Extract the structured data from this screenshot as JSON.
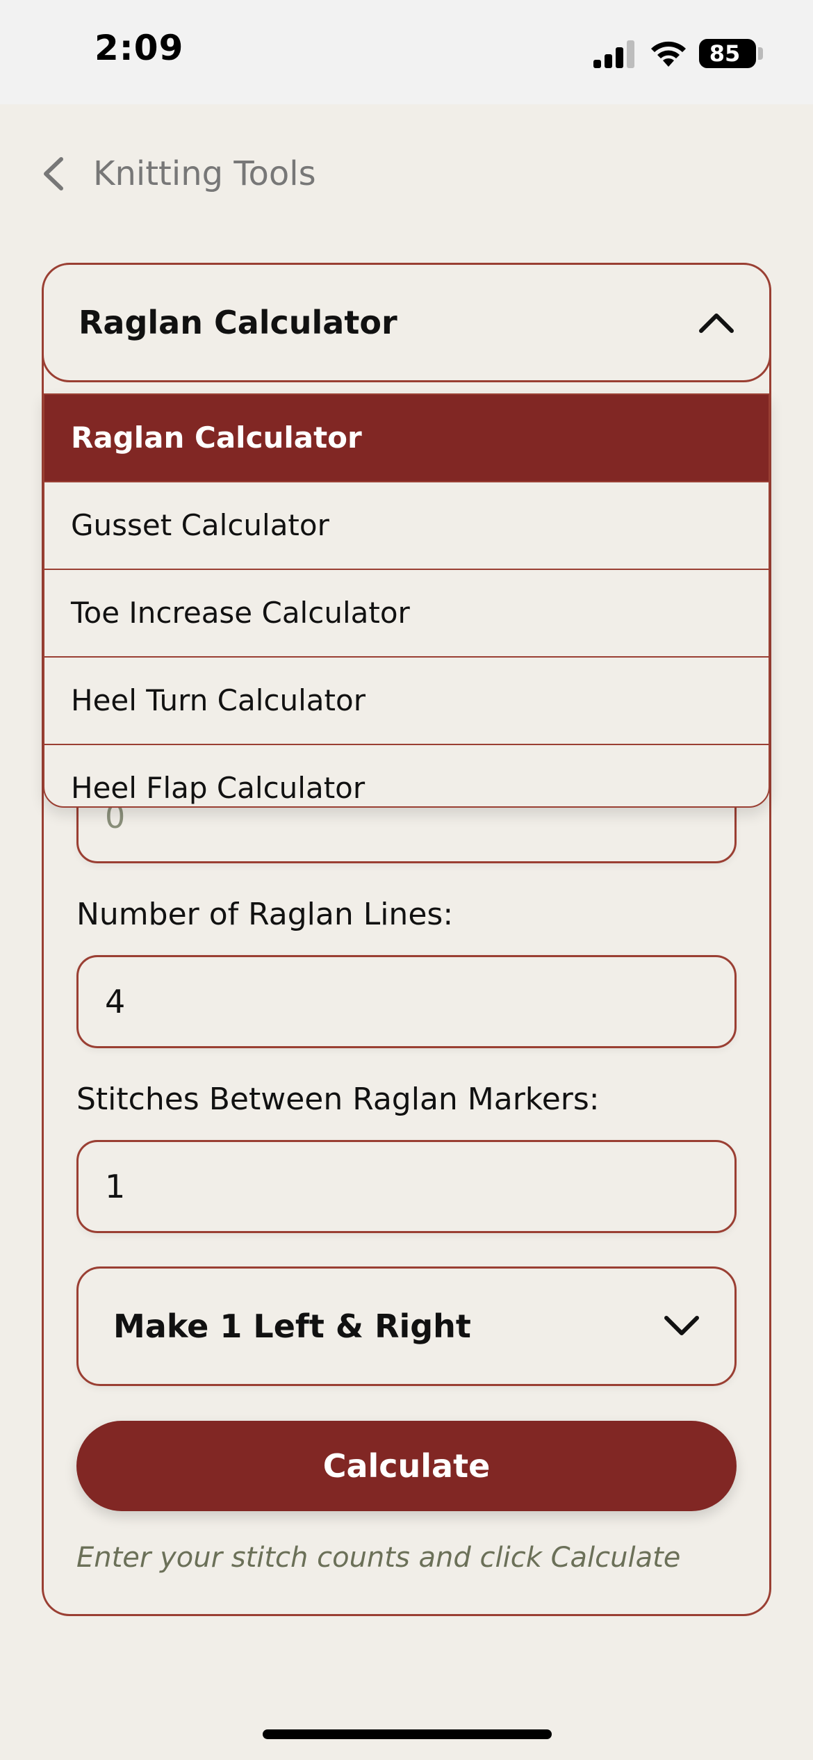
{
  "status_bar": {
    "time": "2:09",
    "battery": "85",
    "icons": [
      "signal-icon",
      "wifi-icon",
      "battery-icon"
    ]
  },
  "nav": {
    "back_label": "Knitting Tools",
    "icon": "chevron-left-icon"
  },
  "calculator_select": {
    "selected": "Raglan Calculator",
    "icon": "chevron-up-icon",
    "options": [
      {
        "label": "Raglan Calculator",
        "selected": true
      },
      {
        "label": "Gusset Calculator",
        "selected": false
      },
      {
        "label": "Toe Increase Calculator",
        "selected": false
      },
      {
        "label": "Heel Turn Calculator",
        "selected": false
      },
      {
        "label": "Heel Flap Calculator",
        "selected": false
      }
    ]
  },
  "form": {
    "hidden_field_value": "0",
    "raglan_lines_label": "Number of Raglan Lines:",
    "raglan_lines_value": "4",
    "stitches_between_label": "Stitches Between Raglan Markers:",
    "stitches_between_value": "1",
    "increase_method": "Make 1 Left & Right",
    "increase_method_icon": "chevron-down-icon",
    "calculate_label": "Calculate",
    "hint": "Enter your stitch counts and click Calculate"
  },
  "colors": {
    "accent": "#812724",
    "border": "#9a3f33",
    "background": "#f1eee8",
    "hint": "#6b7058"
  }
}
